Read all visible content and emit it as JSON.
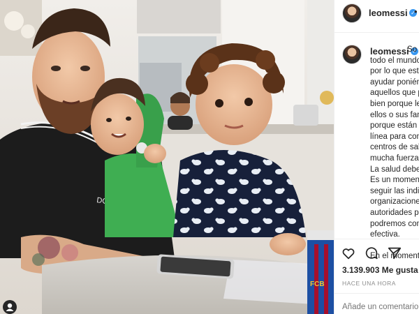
{
  "post": {
    "username": "leomessi",
    "header_more": "•",
    "caption_lines": [
      "So",
      "todo el mundo",
      "por lo que est",
      "ayudar ponién",
      "aquellos que p",
      "bien porque le",
      "ellos o sus fam",
      "porque están",
      "línea para con",
      "centros de sal",
      "mucha fuerza",
      "La salud debe",
      "Es un moment",
      "seguir las indi",
      "organizacione",
      "autoridades p",
      "podremos com",
      "efectiva.",
      "",
      "En el moment"
    ],
    "likes": "3.139.903 Me gusta",
    "time": "HACE UNA HORA",
    "comment_placeholder": "Añade un comentario..."
  },
  "photo": {
    "shirt_text": "DOLCE&G",
    "cup_text": "FCB"
  },
  "icons": {
    "like": "heart-icon",
    "comment": "comment-icon",
    "share": "share-icon",
    "verified": "verified-badge-icon",
    "user_tag": "user-tag-icon"
  },
  "colors": {
    "verified": "#3897f0",
    "text": "#262626",
    "muted": "#8e8e8e"
  }
}
